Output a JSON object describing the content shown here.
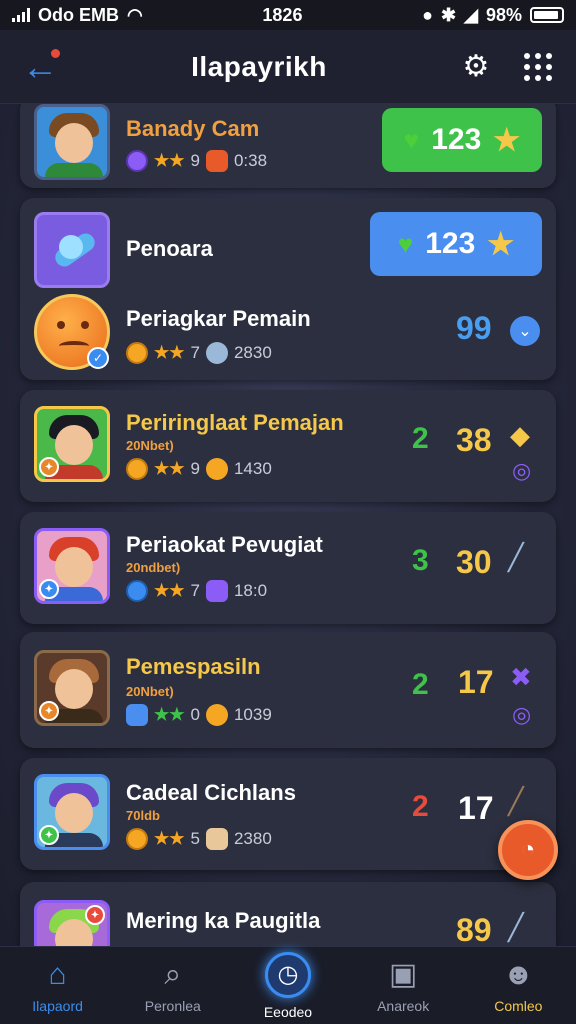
{
  "status": {
    "carrier": "Odo EMB",
    "time": "1826",
    "battery": "98%"
  },
  "header": {
    "title": "Ilapayrikh",
    "back_icon": "arrow-left-icon",
    "settings_icon": "gear-icon",
    "menu_icon": "grid-dots-icon"
  },
  "rows": [
    {
      "name": "Banady Cam",
      "subtitle": "",
      "stars": "9",
      "stat": "0:38",
      "score": "123",
      "score_style": "green-pill"
    },
    {
      "name": "Penoara",
      "subtitle": "",
      "stars": "",
      "stat": "",
      "score": "123",
      "score_style": "blue-pill"
    },
    {
      "name": "Periagkar Pemain",
      "subtitle": "",
      "stars": "7",
      "stat": "2830",
      "score": "99",
      "score_style": "blue-text"
    },
    {
      "name": "Periringlaat Pemajan",
      "subtitle": "20Nbet)",
      "stars": "9",
      "stat": "1430",
      "score": "38",
      "trend": "2"
    },
    {
      "name": "Periaokat Pevugiat",
      "subtitle": "20ndbet)",
      "stars": "7",
      "stat": "18:0",
      "score": "30",
      "trend": "3"
    },
    {
      "name": "Pemespasiln",
      "subtitle": "20Nbet)",
      "stars": "0",
      "stat": "1039",
      "score": "17",
      "trend": "2"
    },
    {
      "name": "Cadeal Cichlans",
      "subtitle": "70ldb",
      "stars": "5",
      "stat": "2380",
      "score": "17",
      "trend": "2"
    },
    {
      "name": "Mering ka Paugitla",
      "subtitle": "",
      "stars": "",
      "stat": "",
      "score": "89",
      "trend": ""
    }
  ],
  "nav": [
    {
      "label": "Ilapaord",
      "icon": "home-icon"
    },
    {
      "label": "Peronlea",
      "icon": "search-icon"
    },
    {
      "label": "Eeodeo",
      "icon": "compass-icon"
    },
    {
      "label": "Anareok",
      "icon": "camera-icon"
    },
    {
      "label": "Comleo",
      "icon": "profile-icon"
    }
  ],
  "colors": {
    "accent": "#3b8cf0",
    "gold": "#f5c84a",
    "green": "#3fc24a",
    "card": "#2c2f3f",
    "fab": "#e85a2a"
  }
}
